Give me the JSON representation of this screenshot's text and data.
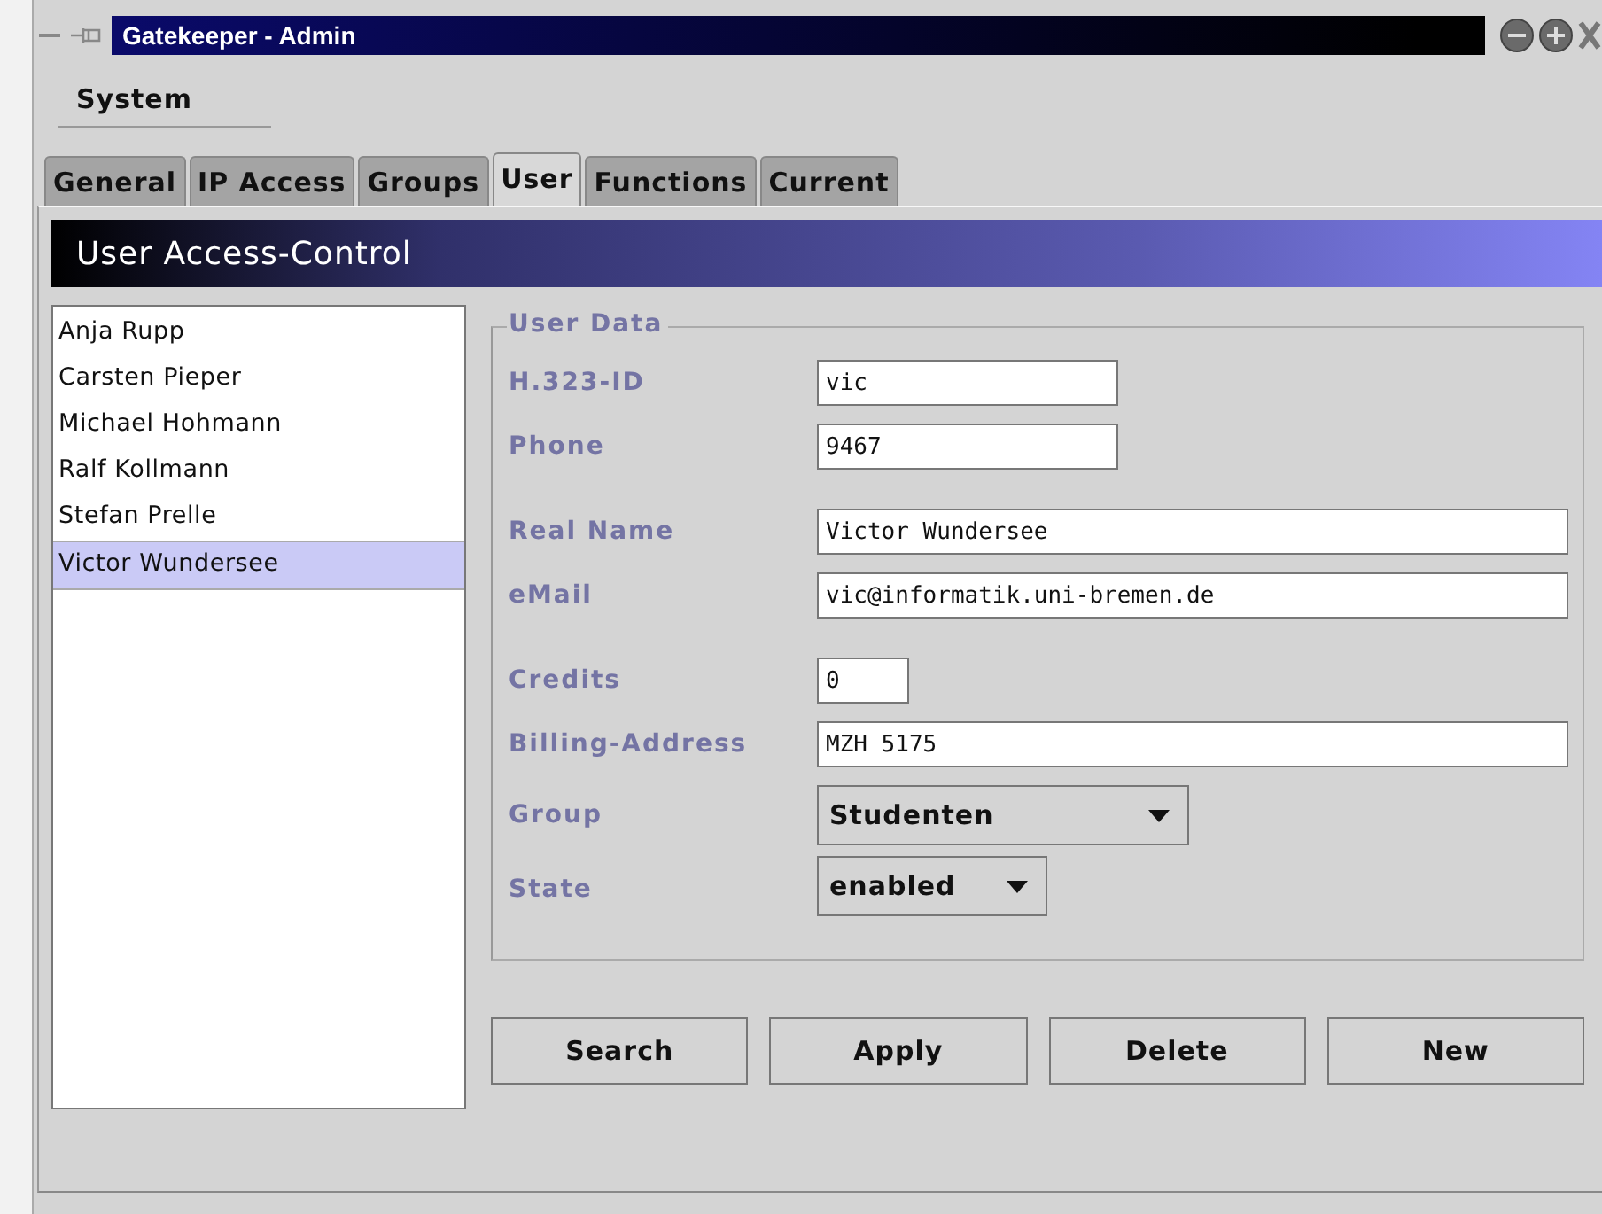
{
  "window": {
    "title": "Gatekeeper - Admin"
  },
  "menu": [
    "System"
  ],
  "tabs": [
    {
      "label": "General",
      "selected": false
    },
    {
      "label": "IP Access",
      "selected": false
    },
    {
      "label": "Groups",
      "selected": false
    },
    {
      "label": "User",
      "selected": true
    },
    {
      "label": "Functions",
      "selected": false
    },
    {
      "label": "Current",
      "selected": false
    }
  ],
  "header": "User Access-Control",
  "users": [
    {
      "name": "Anja Rupp",
      "selected": false
    },
    {
      "name": "Carsten Pieper",
      "selected": false
    },
    {
      "name": "Michael Hohmann",
      "selected": false
    },
    {
      "name": "Ralf Kollmann",
      "selected": false
    },
    {
      "name": "Stefan Prelle",
      "selected": false
    },
    {
      "name": "Victor Wundersee",
      "selected": true
    }
  ],
  "user_data": {
    "title": "User Data",
    "groups": [
      [
        {
          "label": "H.323-ID",
          "kind": "text",
          "value": "vic"
        },
        {
          "label": "Phone",
          "kind": "text",
          "value": "9467"
        }
      ],
      [
        {
          "label": "Real Name",
          "kind": "text",
          "value": "Victor Wundersee"
        },
        {
          "label": "eMail",
          "kind": "text",
          "value": "vic@informatik.uni-bremen.de"
        }
      ],
      [
        {
          "label": "Credits",
          "kind": "text",
          "value": "0"
        },
        {
          "label": "Billing-Address",
          "kind": "text",
          "value": "MZH 5175"
        },
        {
          "label": "Group",
          "kind": "select",
          "value": "Studenten"
        },
        {
          "label": "State",
          "kind": "select",
          "value": "enabled"
        }
      ]
    ]
  },
  "buttons": [
    "Search",
    "Apply",
    "Delete",
    "New"
  ]
}
